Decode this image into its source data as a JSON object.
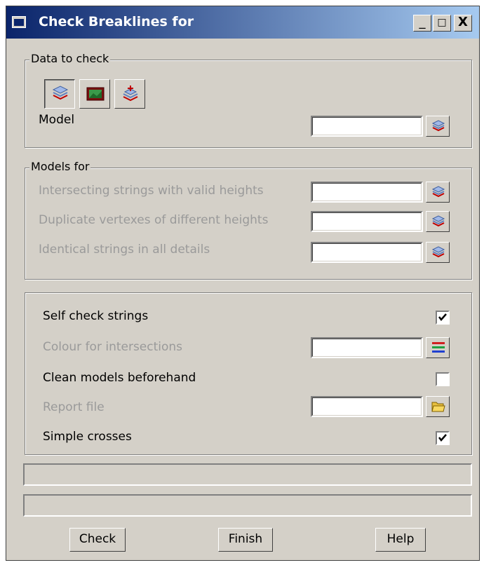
{
  "window": {
    "title": "Check Breaklines for"
  },
  "titlebar_buttons": {
    "minimize": "_",
    "maximize": "□",
    "close": "X"
  },
  "data_to_check": {
    "legend": "Data to check",
    "tools": [
      "model-layers-icon",
      "picture-icon",
      "add-layers-icon"
    ],
    "model_label": "Model",
    "model_value": ""
  },
  "models_for": {
    "legend": "Models for",
    "rows": [
      {
        "label": "Intersecting strings with valid heights",
        "value": ""
      },
      {
        "label": "Duplicate vertexes of different heights",
        "value": ""
      },
      {
        "label": "Identical strings in all details",
        "value": ""
      }
    ]
  },
  "options": {
    "self_check": {
      "label": "Self check strings",
      "checked": true
    },
    "colour": {
      "label": "Colour for intersections",
      "value": ""
    },
    "clean": {
      "label": "Clean models beforehand",
      "checked": false
    },
    "report": {
      "label": "Report file",
      "value": ""
    },
    "simple": {
      "label": "Simple crosses",
      "checked": true
    }
  },
  "status_lines": [
    "",
    ""
  ],
  "buttons": {
    "check": "Check",
    "finish": "Finish",
    "help": "Help"
  },
  "colors": {
    "titlebar_start": "#0a246a",
    "titlebar_end": "#a6caf0",
    "face": "#d4d0c8",
    "disabled_text": "#9a9a9a"
  }
}
